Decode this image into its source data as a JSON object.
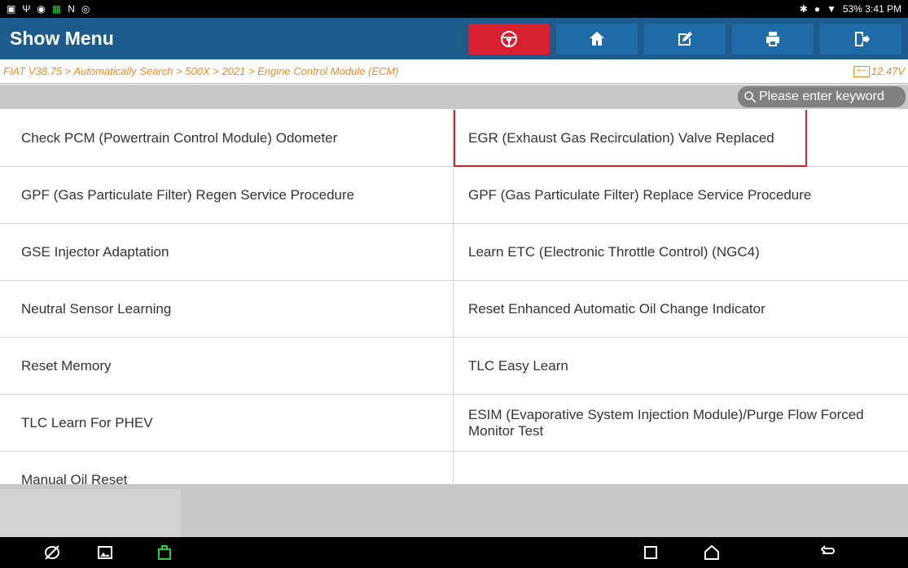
{
  "status_bar": {
    "left_icons": [
      "image-icon",
      "usb-icon",
      "pause-circle-icon",
      "app-icon",
      "n-icon",
      "circle-icon"
    ],
    "right_text": "53%  3:41 PM"
  },
  "header": {
    "title": "Show Menu",
    "buttons": [
      "steering-wheel-icon",
      "home-icon",
      "edit-icon",
      "print-icon",
      "exit-icon"
    ]
  },
  "breadcrumb": {
    "path": "FIAT V38.75 > Automatically Search > 500X > 2021 > Engine Control Module (ECM)",
    "voltage": "12.47V"
  },
  "search": {
    "placeholder": "Please enter keyword"
  },
  "menu": {
    "items": [
      "Check PCM (Powertrain Control Module) Odometer",
      "EGR (Exhaust Gas Recirculation) Valve Replaced",
      "GPF (Gas Particulate Filter) Regen Service Procedure",
      "GPF (Gas Particulate Filter) Replace Service Procedure",
      "GSE Injector Adaptation",
      "Learn ETC (Electronic Throttle Control) (NGC4)",
      "Neutral Sensor Learning",
      "Reset Enhanced Automatic Oil Change Indicator",
      "Reset Memory",
      "TLC Easy Learn",
      "TLC Learn For PHEV",
      "ESIM (Evaporative System Injection Module)/Purge Flow Forced Monitor Test",
      "Manual Oil Reset",
      ""
    ],
    "highlighted_item": "EGR (Exhaust Gas Recirculation) Valve Replaced"
  },
  "colors": {
    "header": "#1d5b8c",
    "button": "#1e6ba7",
    "active_button": "#d82030",
    "breadcrumb": "#f08a1c",
    "highlight": "#d42323"
  }
}
